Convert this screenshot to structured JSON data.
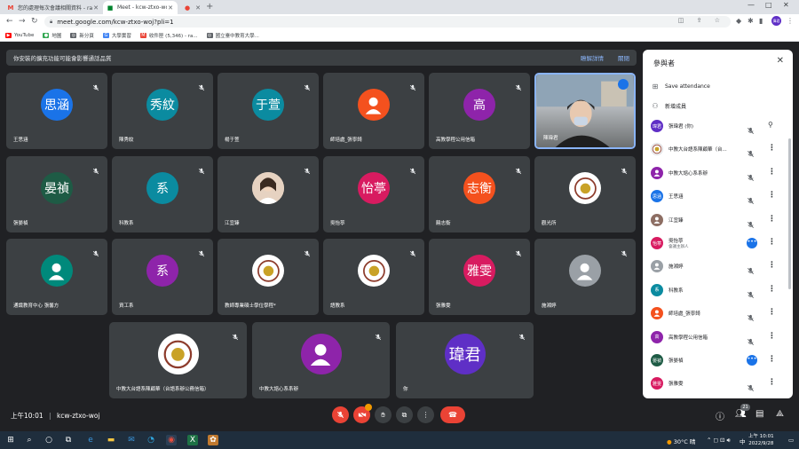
{
  "browser": {
    "tabs": [
      {
        "label": "您的處理每次會議相關資料 - ra...",
        "icon": "gmail-icon",
        "active": false
      },
      {
        "label": "Meet - kcw-ztxo-woj",
        "icon": "meet-icon",
        "active": true
      },
      {
        "label": "",
        "icon": "recording-dot-icon",
        "active": false
      }
    ],
    "url": "meet.google.com/kcw-ztxo-woj?pli=1",
    "profile_initials": "偉君",
    "bookmarks": [
      "YouTube",
      "地圖",
      "新分頁",
      "大學實習",
      "收件匣 (5,346) - ra...",
      "國立臺中教育大學..."
    ]
  },
  "meet": {
    "banner_text": "你安裝的擴充功能可能會影響通話品質",
    "banner_links": [
      "瞭解詳情",
      "關閉"
    ],
    "tiles": [
      {
        "name": "王思涵",
        "avatar_text": "思涵",
        "avatar_color": "#1a73e8"
      },
      {
        "name": "陳秀紋",
        "avatar_text": "秀紋",
        "avatar_color": "#0b8ba0"
      },
      {
        "name": "楊于萱",
        "avatar_text": "于萱",
        "avatar_color": "#0b8ba0"
      },
      {
        "name": "師培處_張寧錡",
        "avatar_text": "",
        "avatar_color": "#f4511e"
      },
      {
        "name": "高教學程公用信箱",
        "avatar_text": "高",
        "avatar_color": "#8e24aa"
      },
      {
        "name": "陳瑋君",
        "avatar_text": "",
        "avatar_color": ""
      },
      {
        "name": "張晏禎",
        "avatar_text": "晏禎",
        "avatar_color": "#1e5b45"
      },
      {
        "name": "科教系",
        "avatar_text": "系",
        "avatar_color": "#0b8ba0"
      },
      {
        "name": "江宜臻",
        "avatar_text": "",
        "avatar_color": "#e6d2c1"
      },
      {
        "name": "吳怡葶",
        "avatar_text": "怡葶",
        "avatar_color": "#d81b60"
      },
      {
        "name": "饒志衡",
        "avatar_text": "志衡",
        "avatar_color": "#f4511e"
      },
      {
        "name": "觀光所",
        "avatar_text": "",
        "avatar_color": "#ffffff"
      },
      {
        "name": "通識教育中心 張馨方",
        "avatar_text": "",
        "avatar_color": "#00897b"
      },
      {
        "name": "資工系",
        "avatar_text": "系",
        "avatar_color": "#8e24aa"
      },
      {
        "name": "教師專業碩士學位學程*",
        "avatar_text": "",
        "avatar_color": "#ffffff"
      },
      {
        "name": "語教系",
        "avatar_text": "",
        "avatar_color": "#ffffff"
      },
      {
        "name": "張雅雯",
        "avatar_text": "雅雯",
        "avatar_color": "#d81b60"
      },
      {
        "name": "施湘婷",
        "avatar_text": "",
        "avatar_color": "#9aa0a6"
      },
      {
        "name": "中教大台語系陳顧華（台語系辦公務信箱）",
        "avatar_text": "",
        "avatar_color": "#ffffff"
      },
      {
        "name": "中教大諮心系系辦",
        "avatar_text": "",
        "avatar_color": "#8e24aa"
      },
      {
        "name": "你",
        "avatar_text": "瑋君",
        "avatar_color": "#5f2fc6"
      }
    ],
    "meeting_time": "上午10:01",
    "meeting_code": "kcw-ztxo-woj",
    "participants_badge": "21"
  },
  "panel": {
    "title": "參與者",
    "actions": [
      "Save attendance",
      "新增成員"
    ],
    "participants": [
      {
        "name": "張瑋君 (你)",
        "sub": "",
        "avatar_text": "瑋君",
        "color": "#5f2fc6",
        "state": "muted-pin"
      },
      {
        "name": "中教大台語系陳顧華（台...",
        "sub": "",
        "avatar_text": "",
        "color": "#ffffff",
        "state": "muted"
      },
      {
        "name": "中教大諮心系系辦",
        "sub": "",
        "avatar_text": "",
        "color": "#8e24aa",
        "state": "muted"
      },
      {
        "name": "王思涵",
        "sub": "",
        "avatar_text": "思涵",
        "color": "#1a73e8",
        "state": "muted"
      },
      {
        "name": "江宜臻",
        "sub": "",
        "avatar_text": "",
        "color": "#8d6e63",
        "state": "muted"
      },
      {
        "name": "吳怡葶",
        "sub": "會議主辦人",
        "avatar_text": "怡葶",
        "color": "#d81b60",
        "state": "speaking"
      },
      {
        "name": "施湘婷",
        "sub": "",
        "avatar_text": "",
        "color": "#9aa0a6",
        "state": "muted"
      },
      {
        "name": "科教系",
        "sub": "",
        "avatar_text": "系",
        "color": "#0b8ba0",
        "state": "muted"
      },
      {
        "name": "師培處_張寧錡",
        "sub": "",
        "avatar_text": "",
        "color": "#f4511e",
        "state": "muted"
      },
      {
        "name": "高教學程公用信箱",
        "sub": "",
        "avatar_text": "高",
        "color": "#8e24aa",
        "state": "muted"
      },
      {
        "name": "張晏禎",
        "sub": "",
        "avatar_text": "晏禎",
        "color": "#1e5b45",
        "state": "speaking"
      },
      {
        "name": "張雅雯",
        "sub": "",
        "avatar_text": "雅雯",
        "color": "#d81b60",
        "state": "muted"
      }
    ]
  },
  "taskbar": {
    "weather": "30°C 晴",
    "ime": "中",
    "clock_time": "上午 10:01",
    "clock_date": "2022/9/28"
  }
}
